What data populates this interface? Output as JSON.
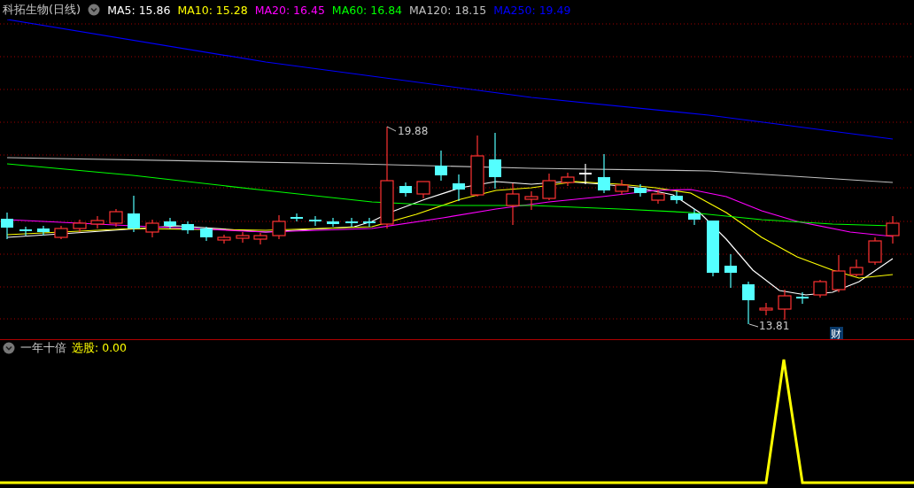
{
  "chart": {
    "title": "科拓生物(日线)",
    "moving_averages": [
      {
        "text": "MA5: 15.86",
        "color": "#ffffff"
      },
      {
        "text": "MA10: 15.28",
        "color": "#ffff00"
      },
      {
        "text": "MA20: 16.45",
        "color": "#ff00ff"
      },
      {
        "text": "MA60: 16.84",
        "color": "#00ff00"
      },
      {
        "text": "MA120: 18.15",
        "color": "#c0c0c0"
      },
      {
        "text": "MA250: 19.49",
        "color": "#0000ff"
      }
    ],
    "high_label": "19.88",
    "low_label": "13.81",
    "badge": "财"
  },
  "indicator": {
    "name": "一年十倍",
    "reading": "选股: 0.00"
  }
}
